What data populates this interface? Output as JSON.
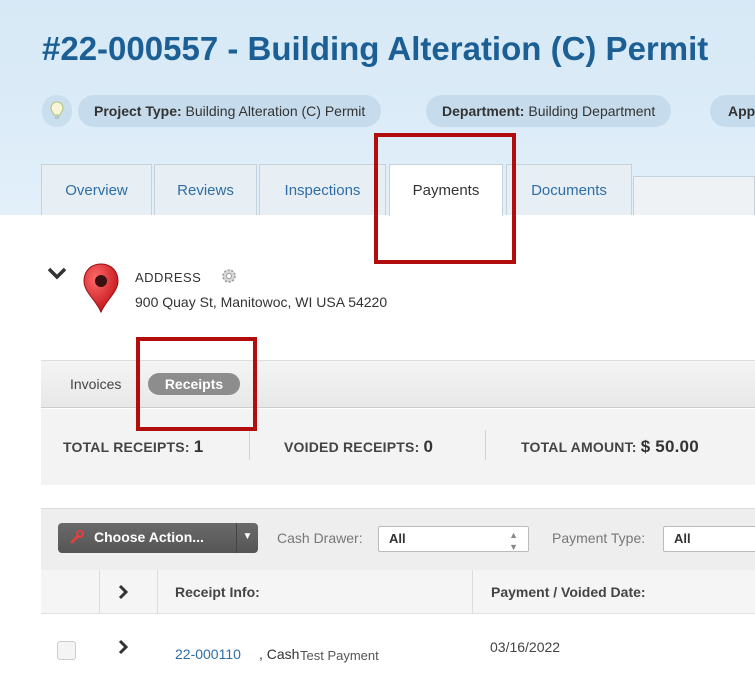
{
  "header": {
    "title": "#22-000557 - Building Alteration (C) Permit",
    "pills": [
      {
        "key": "Project Type:",
        "value": " Building Alteration (C) Permit"
      },
      {
        "key": "Department:",
        "value": " Building Department"
      },
      {
        "key": "App",
        "value": ""
      }
    ]
  },
  "tabs": [
    "Overview",
    "Reviews",
    "Inspections",
    "Payments",
    "Documents"
  ],
  "active_tab": "Payments",
  "address": {
    "label": "ADDRESS",
    "value": "900 Quay St, Manitowoc, WI USA 54220"
  },
  "subtabs": {
    "invoices": "Invoices",
    "receipts": "Receipts",
    "active": "Receipts"
  },
  "totals": {
    "receipts_label": "TOTAL RECEIPTS:",
    "receipts_value": "1",
    "voided_label": "VOIDED RECEIPTS:",
    "voided_value": "0",
    "amount_label": "TOTAL AMOUNT:",
    "amount_value": "$ 50.00"
  },
  "toolbar": {
    "action_label": "Choose Action...",
    "cash_drawer_label": "Cash Drawer:",
    "cash_drawer_value": "All",
    "payment_type_label": "Payment Type:",
    "payment_type_value": "All"
  },
  "table": {
    "columns": [
      "Receipt Info:",
      "Payment / Voided Date:"
    ],
    "rows": [
      {
        "receipt_no": "22-000110",
        "method": ", Cash",
        "note": "Test Payment",
        "date": "03/16/2022"
      }
    ]
  },
  "colors": {
    "title": "#1c5f94",
    "link": "#2e6ea5",
    "highlight": "#b20d0d",
    "header_bg": "#dcecf8"
  },
  "icons": [
    "lightbulb-icon",
    "chevron-down-icon",
    "map-pin-icon",
    "gear-icon",
    "wrench-icon",
    "caret-down-icon",
    "chevron-right-icon",
    "select-arrows-icon"
  ]
}
